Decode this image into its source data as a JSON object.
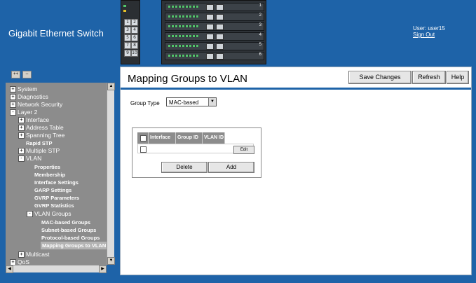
{
  "header": {
    "app_title": "Gigabit Ethernet Switch",
    "user_label": "User: user15",
    "sign_out": "Sign Out",
    "module_keys": [
      "1",
      "2",
      "3",
      "4",
      "5",
      "6",
      "7",
      "8",
      "9",
      "10"
    ],
    "slot_numbers": [
      "1",
      "2",
      "3",
      "4",
      "5",
      "6"
    ]
  },
  "toolbar": {
    "expand_all": "++",
    "collapse_all": "--"
  },
  "nav": {
    "items": [
      {
        "label": "System",
        "sign": "+"
      },
      {
        "label": "Diagnostics",
        "sign": "+"
      },
      {
        "label": "Network Security",
        "sign": "+"
      },
      {
        "label": "Layer 2",
        "sign": "-"
      },
      {
        "label": "Interface",
        "sign": "+"
      },
      {
        "label": "Address Table",
        "sign": "+"
      },
      {
        "label": "Spanning Tree",
        "sign": "+"
      },
      {
        "label": "Rapid STP"
      },
      {
        "label": "Multiple STP",
        "sign": "+"
      },
      {
        "label": "VLAN",
        "sign": "-"
      },
      {
        "label": "Properties"
      },
      {
        "label": "Membership"
      },
      {
        "label": "Interface Settings"
      },
      {
        "label": "GARP Settings"
      },
      {
        "label": "GVRP Parameters"
      },
      {
        "label": "GVRP Statistics"
      },
      {
        "label": "VLAN Groups",
        "sign": "-"
      },
      {
        "label": "MAC-based Groups"
      },
      {
        "label": "Subnet-based Groups"
      },
      {
        "label": "Protocol-based Groups"
      },
      {
        "label": "Mapping Groups to VLAN"
      },
      {
        "label": "Multicast",
        "sign": "+"
      },
      {
        "label": "QoS",
        "sign": "+"
      }
    ]
  },
  "main": {
    "title": "Mapping Groups to VLAN",
    "buttons": {
      "save": "Save Changes",
      "refresh": "Refresh",
      "help": "Help"
    },
    "group_type_label": "Group Type",
    "group_type_value": "MAC-based",
    "table": {
      "columns": [
        "Interface",
        "Group ID",
        "VLAN ID"
      ],
      "edit_label": "Edit"
    },
    "delete_label": "Delete",
    "add_label": "Add"
  },
  "colors": {
    "header_bg": "#1e63a8",
    "nav_bg": "#8c8c8c",
    "table_head": "#8c8c8c"
  },
  "icons": {
    "plus": "plus-box-icon",
    "minus": "minus-box-icon",
    "dropdown": "chevron-down-icon"
  }
}
